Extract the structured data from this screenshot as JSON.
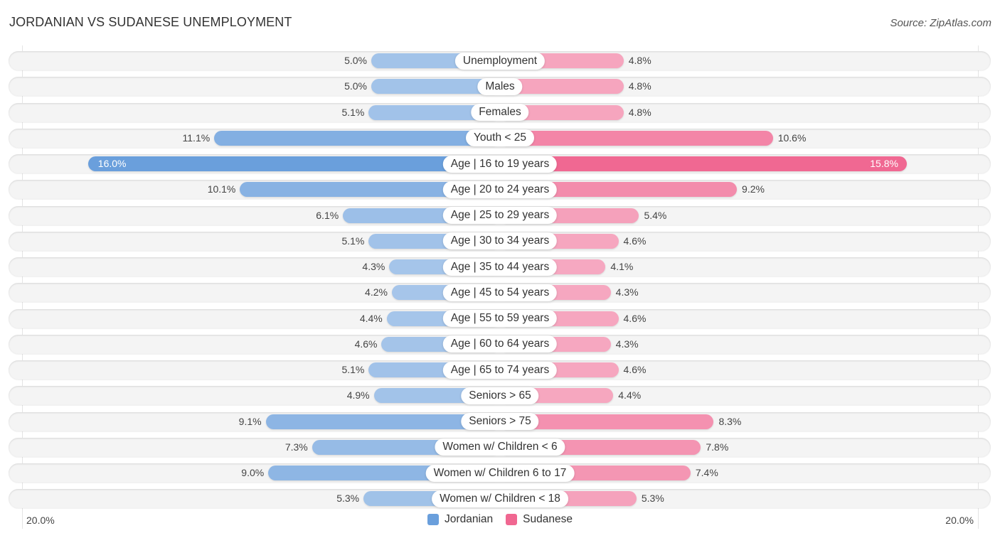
{
  "title": "JORDANIAN VS SUDANESE UNEMPLOYMENT",
  "source": "Source: ZipAtlas.com",
  "colors": {
    "jordanian": "#6a9fdc",
    "jordanian_light": "#a7c6ea",
    "sudanese": "#f06791",
    "sudanese_light": "#f6a9c1"
  },
  "chart_data": {
    "type": "bar",
    "orientation": "horizontal-diverging",
    "title": "JORDANIAN VS SUDANESE UNEMPLOYMENT",
    "xlabel": "",
    "ylabel": "",
    "xlim": [
      0,
      20
    ],
    "axis_left_label": "20.0%",
    "axis_right_label": "20.0%",
    "legend_position": "bottom-center",
    "categories": [
      "Unemployment",
      "Males",
      "Females",
      "Youth < 25",
      "Age | 16 to 19 years",
      "Age | 20 to 24 years",
      "Age | 25 to 29 years",
      "Age | 30 to 34 years",
      "Age | 35 to 44 years",
      "Age | 45 to 54 years",
      "Age | 55 to 59 years",
      "Age | 60 to 64 years",
      "Age | 65 to 74 years",
      "Seniors > 65",
      "Seniors > 75",
      "Women w/ Children < 6",
      "Women w/ Children 6 to 17",
      "Women w/ Children < 18"
    ],
    "series": [
      {
        "name": "Jordanian",
        "side": "left",
        "values": [
          5.0,
          5.0,
          5.1,
          11.1,
          16.0,
          10.1,
          6.1,
          5.1,
          4.3,
          4.2,
          4.4,
          4.6,
          5.1,
          4.9,
          9.1,
          7.3,
          9.0,
          5.3
        ],
        "labels": [
          "5.0%",
          "5.0%",
          "5.1%",
          "11.1%",
          "16.0%",
          "10.1%",
          "6.1%",
          "5.1%",
          "4.3%",
          "4.2%",
          "4.4%",
          "4.6%",
          "5.1%",
          "4.9%",
          "9.1%",
          "7.3%",
          "9.0%",
          "5.3%"
        ]
      },
      {
        "name": "Sudanese",
        "side": "right",
        "values": [
          4.8,
          4.8,
          4.8,
          10.6,
          15.8,
          9.2,
          5.4,
          4.6,
          4.1,
          4.3,
          4.6,
          4.3,
          4.6,
          4.4,
          8.3,
          7.8,
          7.4,
          5.3
        ],
        "labels": [
          "4.8%",
          "4.8%",
          "4.8%",
          "10.6%",
          "15.8%",
          "9.2%",
          "5.4%",
          "4.6%",
          "4.1%",
          "4.3%",
          "4.6%",
          "4.3%",
          "4.6%",
          "4.4%",
          "8.3%",
          "7.8%",
          "7.4%",
          "5.3%"
        ]
      }
    ],
    "highlighted_row": "Age | 16 to 19 years"
  },
  "legend": [
    {
      "name": "Jordanian",
      "color": "#6a9fdc"
    },
    {
      "name": "Sudanese",
      "color": "#f06791"
    }
  ]
}
